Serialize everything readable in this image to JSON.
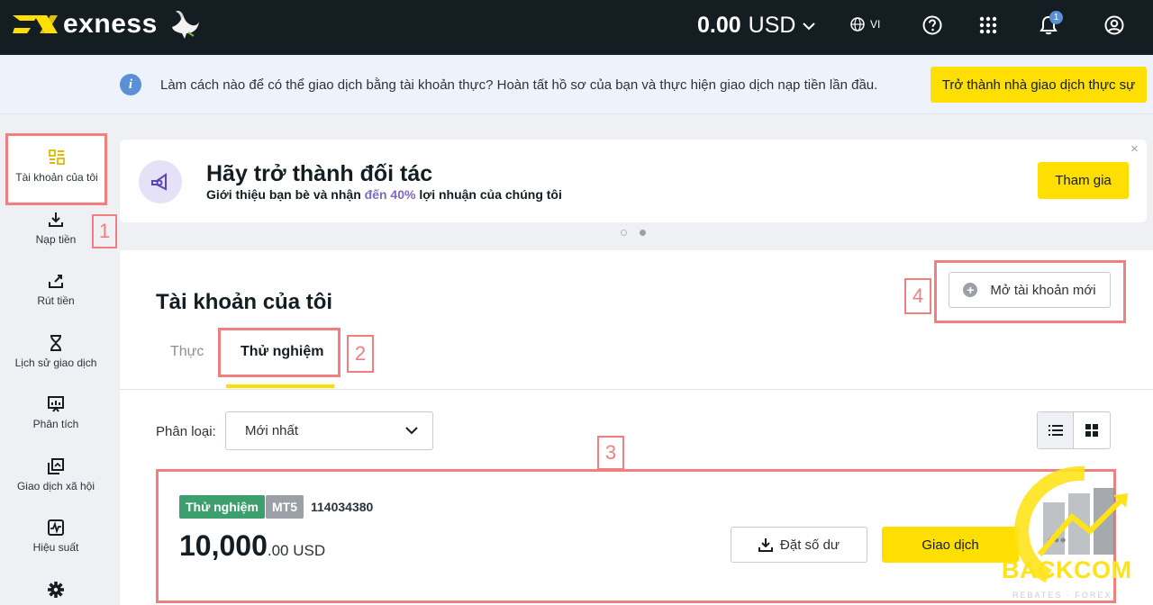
{
  "header": {
    "brand": "exness",
    "balance_amount": "0.00",
    "balance_currency": "USD",
    "language": "VI",
    "notification_count": "1"
  },
  "info_banner": {
    "text": "Làm cách nào để có thể giao dịch bằng tài khoản thực? Hoàn tất hồ sơ của bạn và thực hiện giao dịch nạp tiền lần đầu.",
    "button_label": "Trở thành nhà giao dịch thực sự"
  },
  "sidebar": {
    "items": [
      {
        "label": "Tài khoản của tôi",
        "icon": "grid-icon"
      },
      {
        "label": "Nạp tiền",
        "icon": "download-icon"
      },
      {
        "label": "Rút tiền",
        "icon": "upload-icon"
      },
      {
        "label": "Lịch sử giao dịch",
        "icon": "hourglass-icon"
      },
      {
        "label": "Phân tích",
        "icon": "chart-icon"
      },
      {
        "label": "Giao dịch xã hội",
        "icon": "copy-icon"
      },
      {
        "label": "Hiệu suất",
        "icon": "performance-icon"
      },
      {
        "label": "",
        "icon": "gear-icon"
      }
    ]
  },
  "partner": {
    "title": "Hãy trở thành đối tác",
    "subtitle_prefix": "Giới thiệu bạn bè và nhận ",
    "subtitle_highlight": "đến 40%",
    "subtitle_suffix": " lợi nhuận của chúng tôi",
    "button_label": "Tham gia",
    "close": "×"
  },
  "accounts_panel": {
    "title": "Tài khoản của tôi",
    "open_button_label": "Mở tài khoản mới",
    "tabs": [
      {
        "label": "Thực",
        "active": false
      },
      {
        "label": "Thử nghiệm",
        "active": true
      }
    ],
    "filter_label": "Phân loại:",
    "filter_value": "Mới nhất"
  },
  "account_card": {
    "type_tag": "Thử nghiệm",
    "platform_tag": "MT5",
    "account_number": "114034380",
    "balance_whole": "10,000",
    "balance_fraction": ".00 USD",
    "set_balance_label": "Đặt số dư",
    "trade_label": "Giao dịch"
  },
  "annotations": [
    "1",
    "2",
    "3",
    "4"
  ],
  "watermark": {
    "text": "BACKCOM",
    "sub": "REBATES · FOREX"
  },
  "colors": {
    "topbar": "#141d22",
    "accent_yellow": "#ffde02",
    "demo_green": "#3e9f6e",
    "highlight_red": "#f08080",
    "info_blue": "#5b8fd6"
  }
}
